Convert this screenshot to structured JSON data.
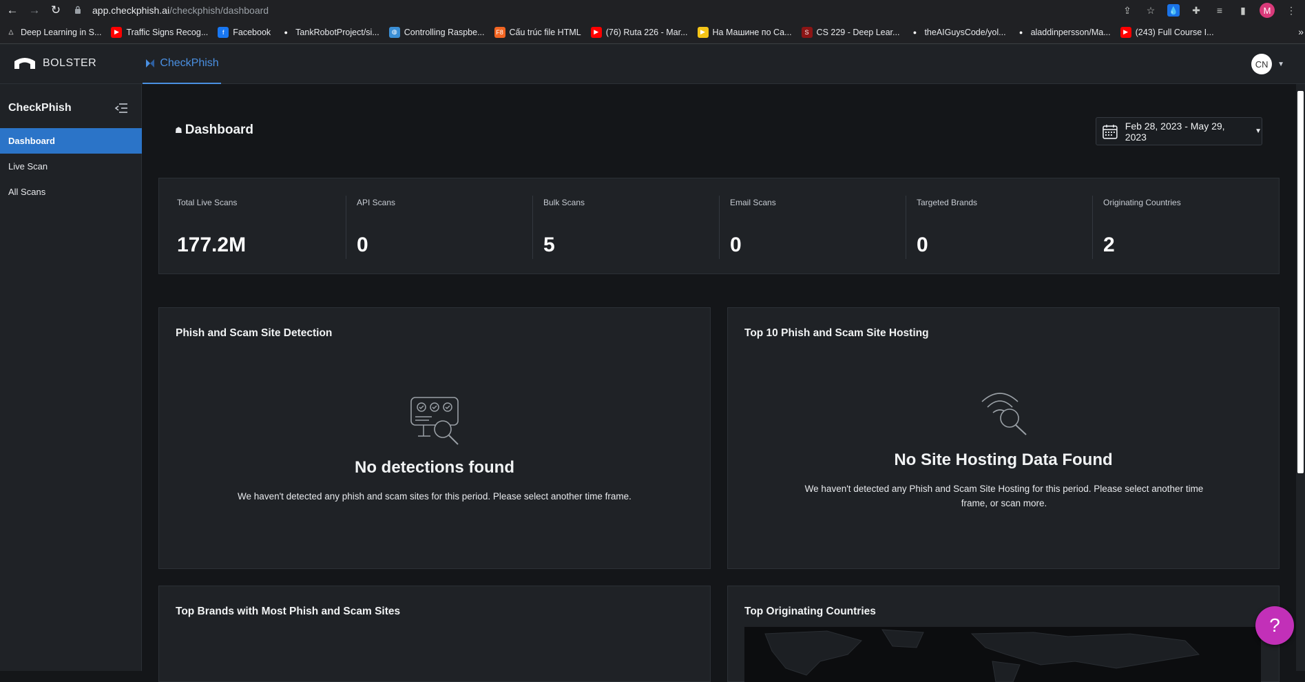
{
  "browser": {
    "url_host": "app.checkphish.ai",
    "url_path": "/checkphish/dashboard",
    "profile_initial": "M",
    "bookmarks": [
      {
        "label": "Deep Learning in S...",
        "icon": "triangle-icon",
        "color": "#202124"
      },
      {
        "label": "Traffic Signs Recog...",
        "icon": "youtube-icon",
        "color": "#ff0000"
      },
      {
        "label": "Facebook",
        "icon": "facebook-icon",
        "color": "#1877f2"
      },
      {
        "label": "TankRobotProject/si...",
        "icon": "github-icon",
        "color": "#202124"
      },
      {
        "label": "Controlling Raspbe...",
        "icon": "globe-icon",
        "color": "#3b8fd6"
      },
      {
        "label": "Cấu trúc file HTML",
        "icon": "f8-icon",
        "color": "#f26522"
      },
      {
        "label": "(76) Ruta 226 - Mar...",
        "icon": "youtube-icon",
        "color": "#ff0000"
      },
      {
        "label": "На Машине по Са...",
        "icon": "play-icon",
        "color": "#f5c518"
      },
      {
        "label": "CS 229 - Deep Lear...",
        "icon": "stanford-icon",
        "color": "#8c1515"
      },
      {
        "label": "theAIGuysCode/yol...",
        "icon": "github-icon",
        "color": "#202124"
      },
      {
        "label": "aladdinpersson/Ma...",
        "icon": "github-icon",
        "color": "#202124"
      },
      {
        "label": "(243) Full Course I...",
        "icon": "youtube-icon",
        "color": "#ff0000"
      }
    ],
    "bookmarks_more": "»"
  },
  "header": {
    "brand": "BOLSTER",
    "tab_label": "CheckPhish",
    "user_initials": "CN"
  },
  "sidebar": {
    "title": "CheckPhish",
    "items": [
      {
        "label": "Dashboard",
        "active": true
      },
      {
        "label": "Live Scan",
        "active": false
      },
      {
        "label": "All Scans",
        "active": false
      }
    ]
  },
  "main": {
    "title": "Dashboard",
    "date_range": "Feb 28, 2023 - May 29, 2023",
    "stats": [
      {
        "label": "Total Live Scans",
        "value": "177.2M"
      },
      {
        "label": "API Scans",
        "value": "0"
      },
      {
        "label": "Bulk Scans",
        "value": "5"
      },
      {
        "label": "Email Scans",
        "value": "0"
      },
      {
        "label": "Targeted Brands",
        "value": "0"
      },
      {
        "label": "Originating Countries",
        "value": "2"
      }
    ],
    "cards": {
      "detection": {
        "title": "Phish and Scam Site Detection",
        "empty_title": "No detections found",
        "empty_text": "We haven't detected any phish and scam sites for this period. Please select another time frame."
      },
      "hosting": {
        "title": "Top 10 Phish and Scam Site Hosting",
        "empty_title": "No Site Hosting Data Found",
        "empty_text": "We haven't detected any Phish and Scam Site Hosting for this period. Please select another time frame, or scan more."
      },
      "brands": {
        "title": "Top Brands with Most Phish and Scam Sites"
      },
      "countries": {
        "title": "Top Originating Countries"
      }
    },
    "help_label": "?"
  },
  "colors": {
    "accent": "#4a90e2",
    "active_nav": "#2b74c8",
    "help_button": "#c230b8"
  }
}
